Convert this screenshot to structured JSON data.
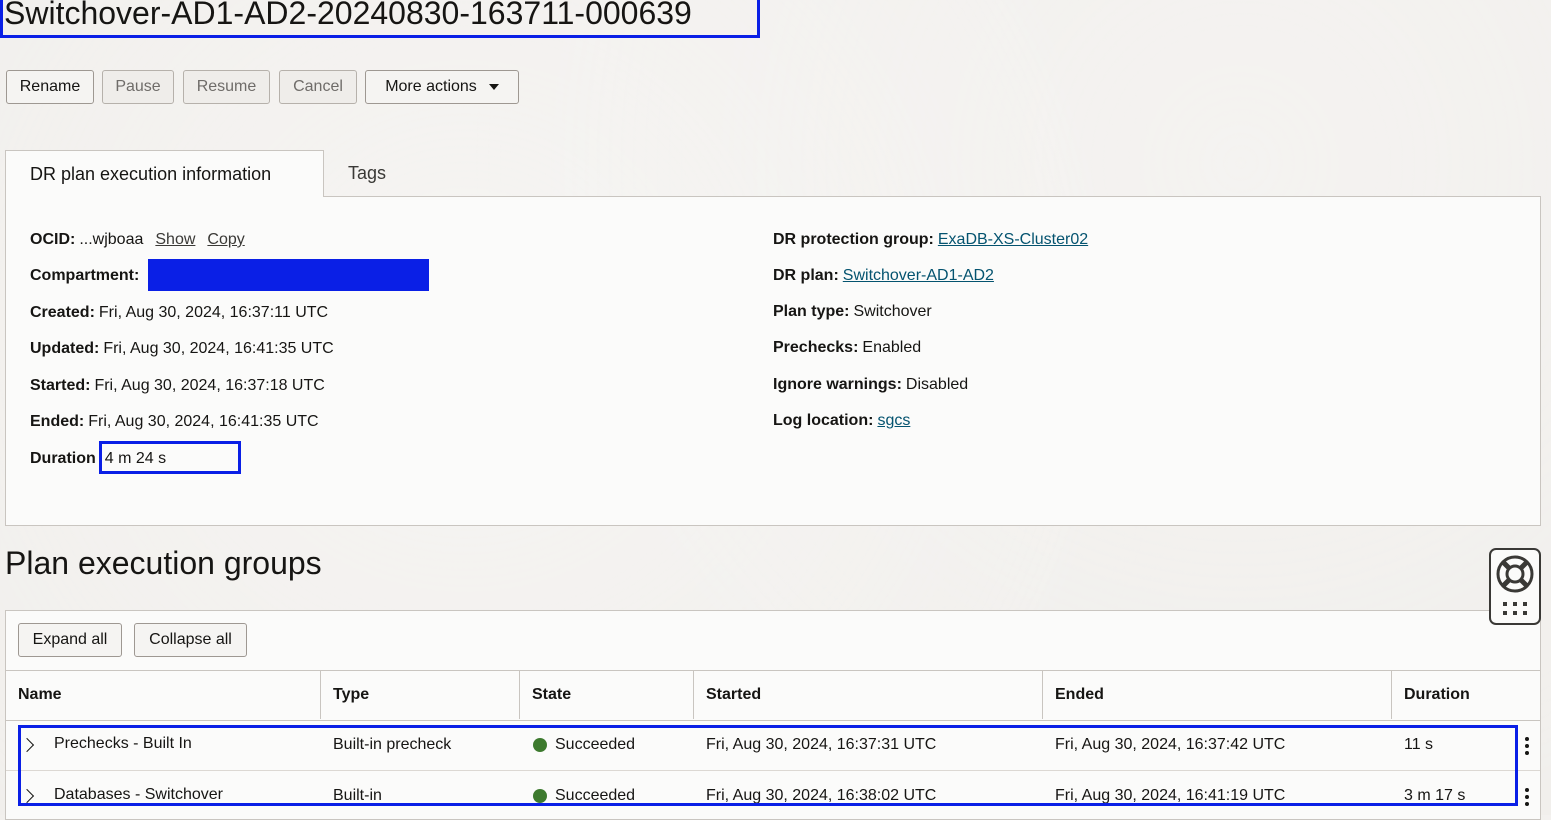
{
  "header": {
    "title": "Switchover-AD1-AD2-20240830-163711-000639"
  },
  "actions": {
    "rename": "Rename",
    "pause": "Pause",
    "resume": "Resume",
    "cancel": "Cancel",
    "more": "More actions"
  },
  "tabs": [
    {
      "label": "DR plan execution information",
      "active": true
    },
    {
      "label": "Tags",
      "active": false
    }
  ],
  "info": {
    "ocid_label": "OCID:",
    "ocid_value": "...wjboaa",
    "show": "Show",
    "copy": "Copy",
    "compartment_label": "Compartment:",
    "created_label": "Created:",
    "created_value": "Fri, Aug 30, 2024, 16:37:11 UTC",
    "updated_label": "Updated:",
    "updated_value": "Fri, Aug 30, 2024, 16:41:35 UTC",
    "started_label": "Started:",
    "started_value": "Fri, Aug 30, 2024, 16:37:18 UTC",
    "ended_label": "Ended:",
    "ended_value": "Fri, Aug 30, 2024, 16:41:35 UTC",
    "duration_label": "Duration",
    "duration_value": "4 m 24 s",
    "pg_label": "DR protection group:",
    "pg_value": "ExaDB-XS-Cluster02",
    "plan_label": "DR plan:",
    "plan_value": "Switchover-AD1-AD2",
    "plantype_label": "Plan type:",
    "plantype_value": "Switchover",
    "prechecks_label": "Prechecks:",
    "prechecks_value": "Enabled",
    "ignore_label": "Ignore warnings:",
    "ignore_value": "Disabled",
    "log_label": "Log location:",
    "log_value": "sgcs"
  },
  "groups": {
    "title": "Plan execution groups",
    "expand_all": "Expand all",
    "collapse_all": "Collapse all",
    "columns": [
      "Name",
      "Type",
      "State",
      "Started",
      "Ended",
      "Duration"
    ],
    "rows": [
      {
        "name": "Prechecks - Built In",
        "type": "Built-in precheck",
        "state": "Succeeded",
        "started": "Fri, Aug 30, 2024, 16:37:31 UTC",
        "ended": "Fri, Aug 30, 2024, 16:37:42 UTC",
        "duration": "11 s"
      },
      {
        "name": "Databases - Switchover",
        "type": "Built-in",
        "state": "Succeeded",
        "started": "Fri, Aug 30, 2024, 16:38:02 UTC",
        "ended": "Fri, Aug 30, 2024, 16:41:19 UTC",
        "duration": "3 m 17 s"
      }
    ]
  },
  "colors": {
    "accent_highlight": "#0a1fe6",
    "link": "#04536f",
    "success": "#3d7a2e"
  },
  "icons": {
    "help": "lifebuoy-icon",
    "apps": "grid-icon",
    "row_expand": "chevron-right-icon",
    "row_menu": "kebab-menu-icon"
  }
}
